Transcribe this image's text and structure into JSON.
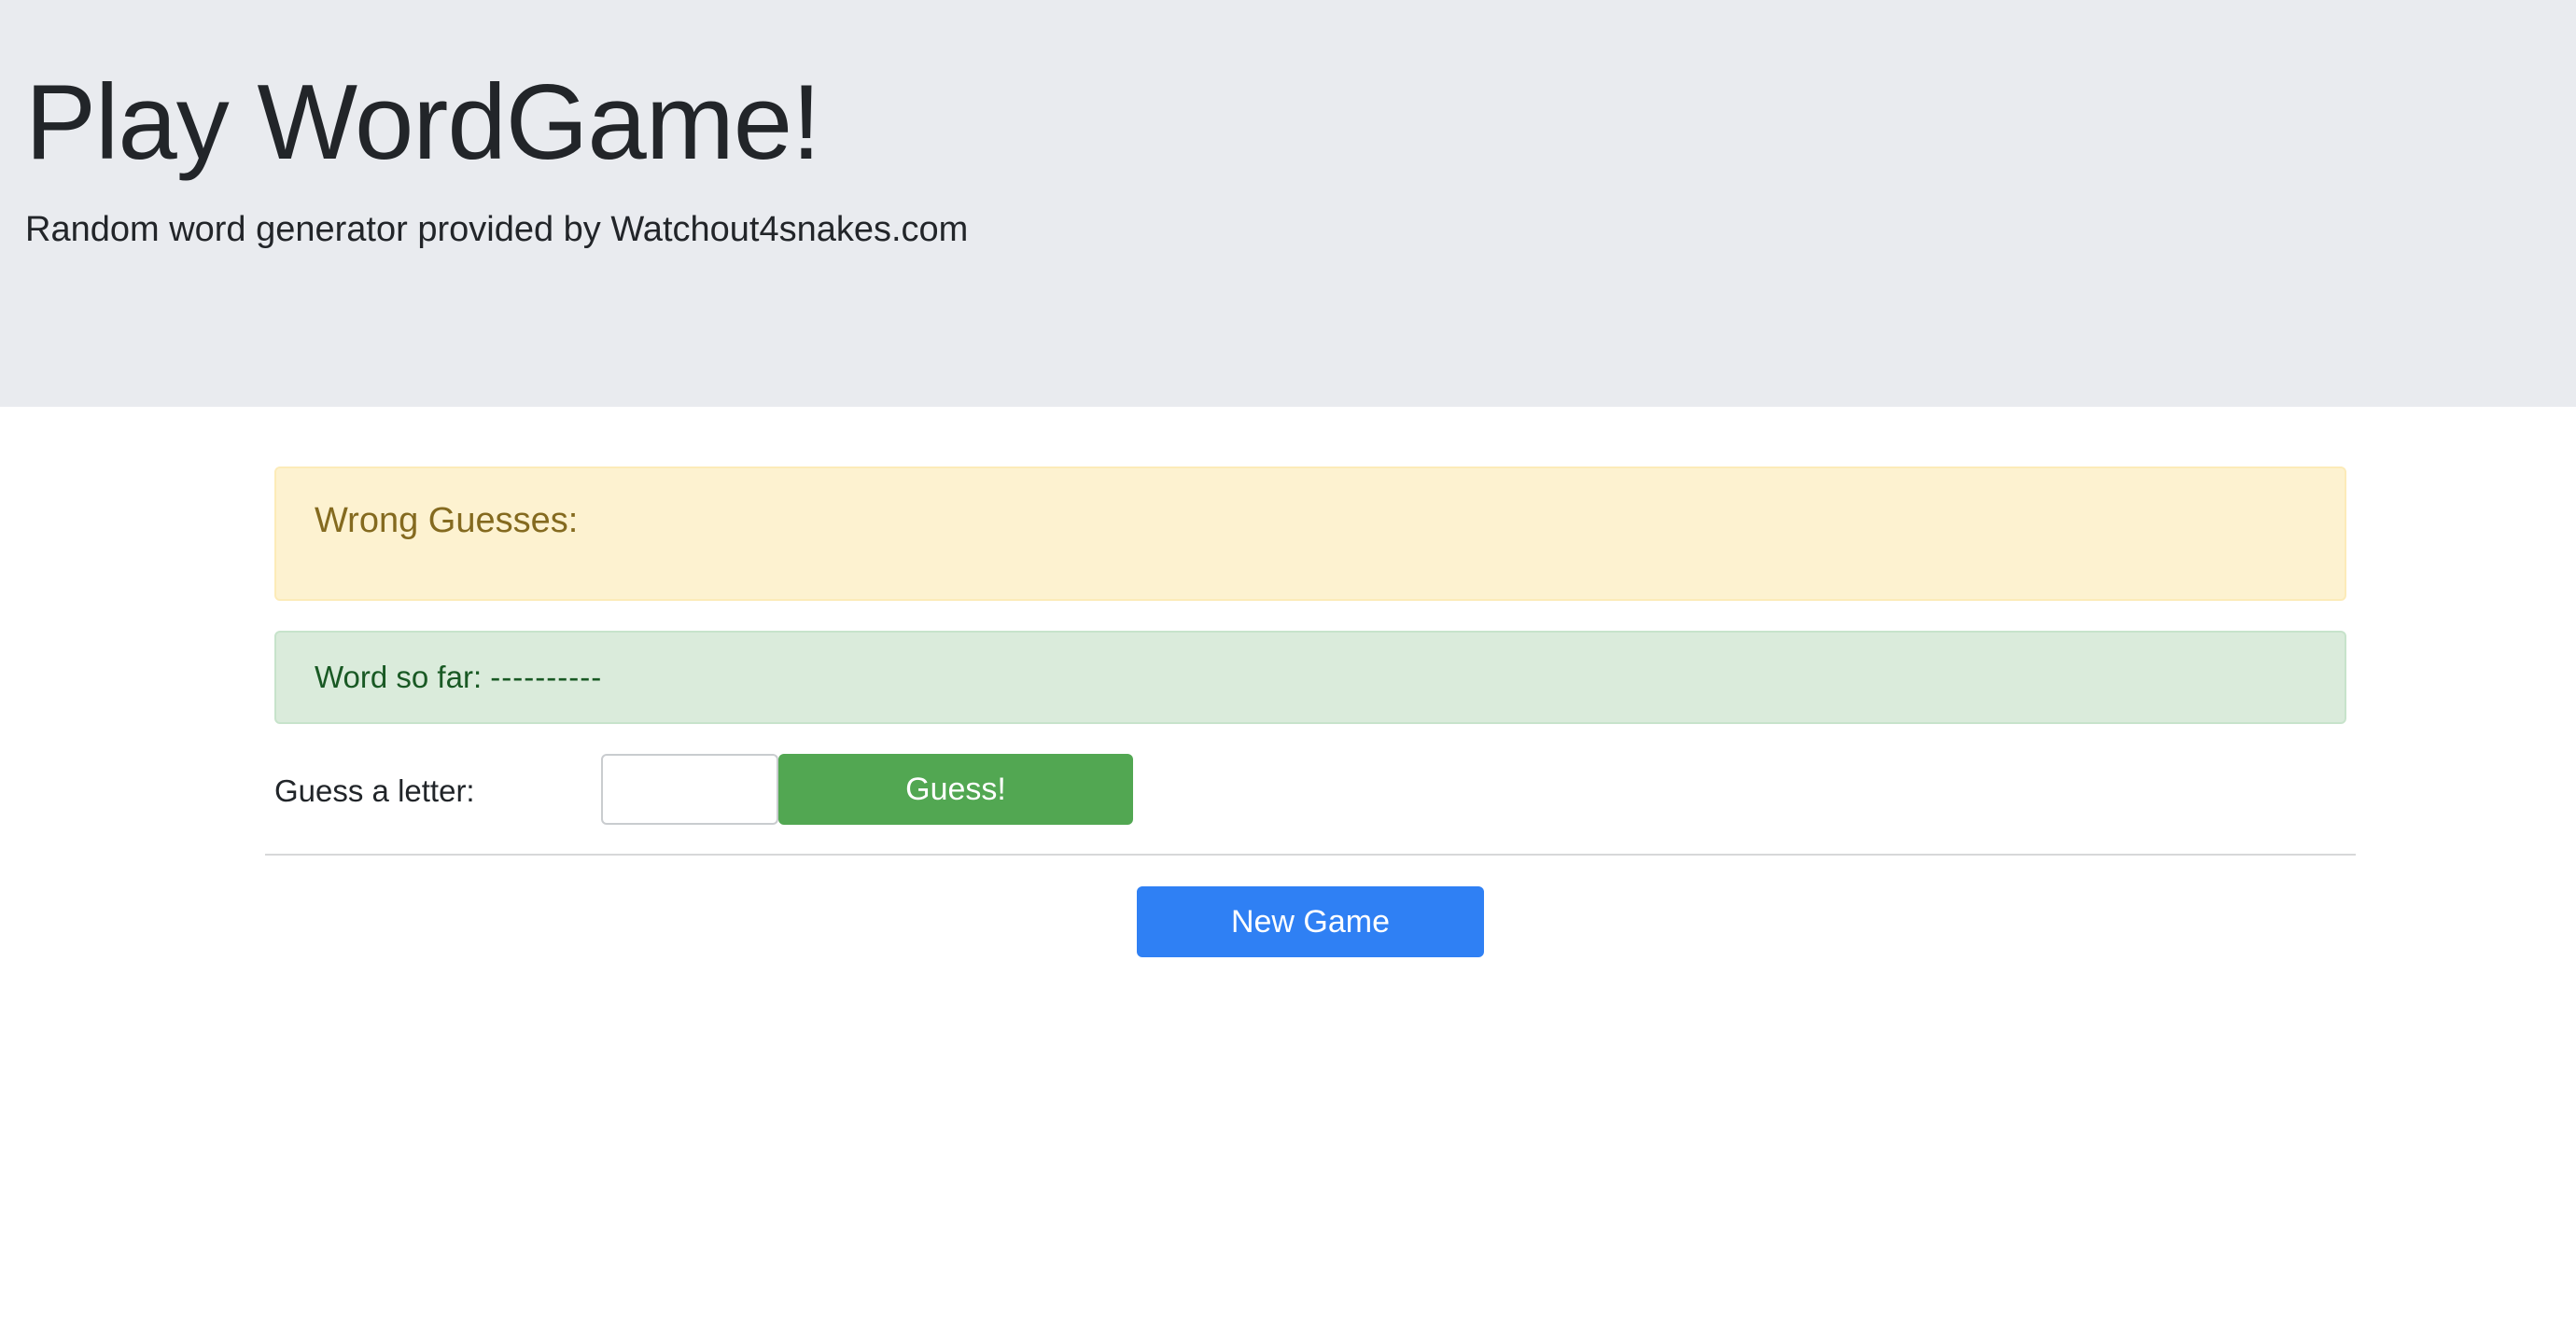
{
  "header": {
    "title": "Play WordGame!",
    "subtitle": "Random word generator provided by Watchout4snakes.com"
  },
  "wrong_guesses": {
    "label": "Wrong Guesses:",
    "letters": ""
  },
  "word_progress": {
    "label": "Word so far:",
    "value": "----------"
  },
  "guess_form": {
    "label": "Guess a letter:",
    "input_value": "",
    "submit_label": "Guess!"
  },
  "actions": {
    "new_game_label": "New Game"
  },
  "colors": {
    "header_bg": "#e9ebef",
    "warning_bg": "#fdf2d0",
    "success_bg": "#daebdb",
    "guess_button": "#52a752",
    "new_game_button": "#2f80f4"
  }
}
